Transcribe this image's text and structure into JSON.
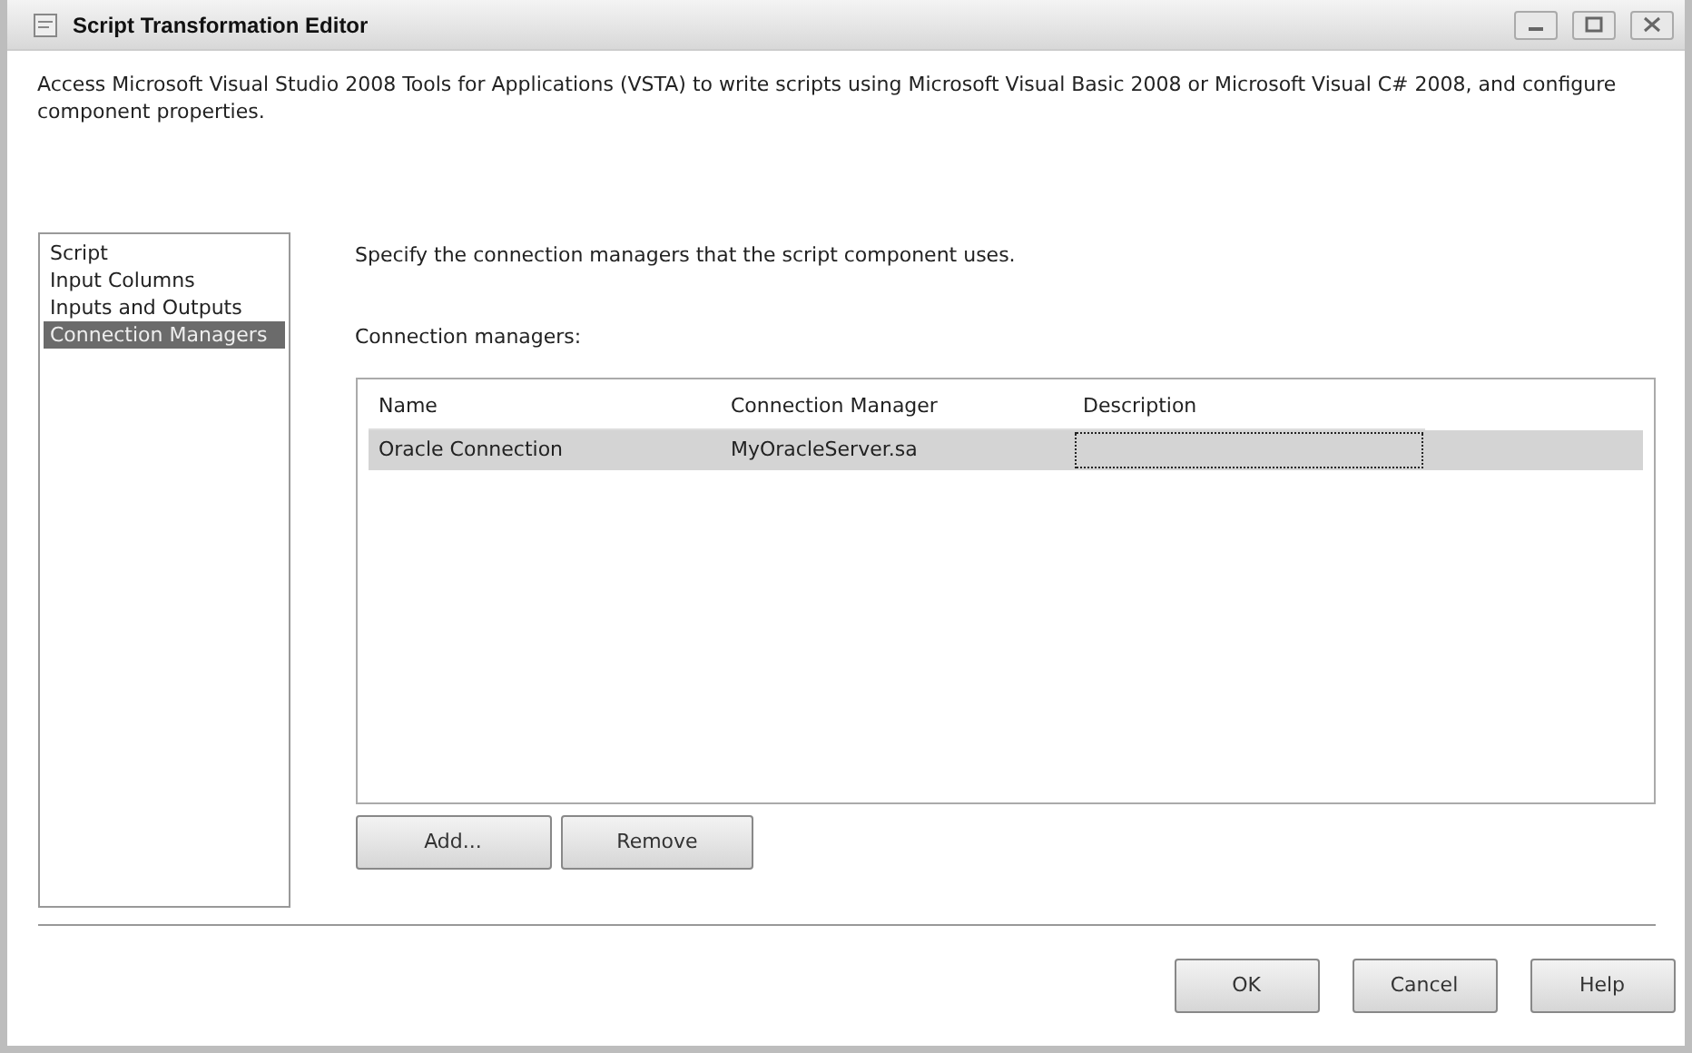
{
  "window": {
    "title": "Script Transformation Editor"
  },
  "description": "Access Microsoft Visual Studio 2008 Tools for Applications (VSTA) to write scripts using Microsoft Visual Basic 2008 or Microsoft Visual C# 2008, and configure component properties.",
  "pages": [
    {
      "label": "Script",
      "selected": false
    },
    {
      "label": "Input Columns",
      "selected": false
    },
    {
      "label": "Inputs and Outputs",
      "selected": false
    },
    {
      "label": "Connection Managers",
      "selected": true
    }
  ],
  "instruction": "Specify the connection managers that the script component uses.",
  "list_label": "Connection managers:",
  "table": {
    "columns": [
      "Name",
      "Connection Manager",
      "Description"
    ],
    "rows": [
      {
        "selected": true,
        "cells": [
          {
            "text": "Oracle Connection",
            "focused": false
          },
          {
            "text": "MyOracleServer.sa",
            "focused": false
          },
          {
            "focused": true
          }
        ]
      }
    ]
  },
  "table_buttons": [
    "Add...",
    "Remove"
  ],
  "dialog_buttons": [
    "OK",
    "Cancel",
    "Help"
  ]
}
